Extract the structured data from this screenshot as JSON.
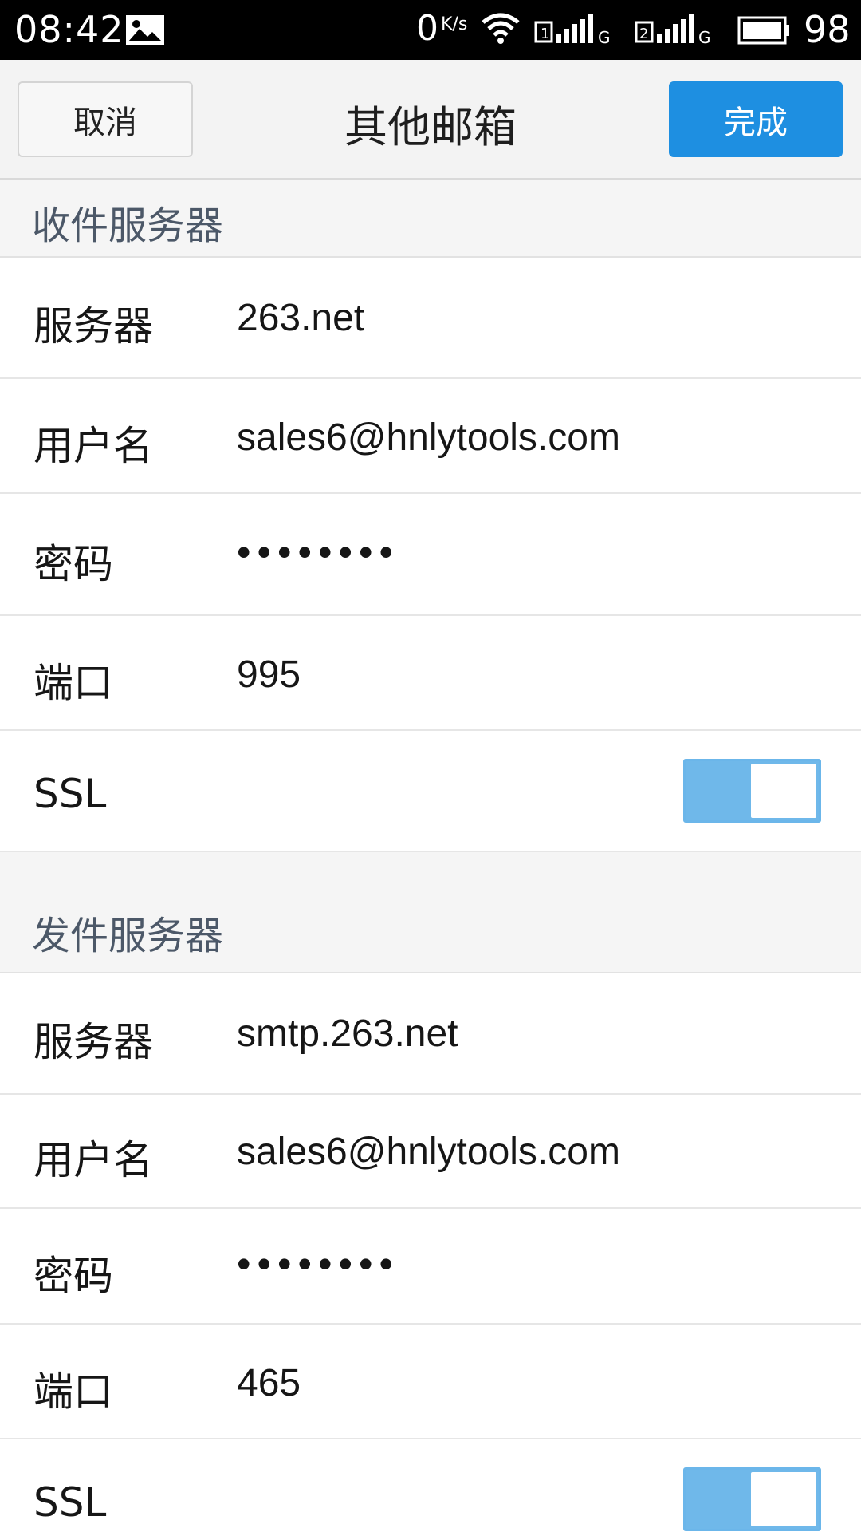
{
  "status_bar": {
    "time": "08:42",
    "net_speed": "0",
    "net_speed_unit": "K/s",
    "sim1": "1",
    "sim2": "2",
    "network_type": "G",
    "battery": "98",
    "icons": [
      "image-icon",
      "wifi-icon",
      "signal-icon",
      "battery-icon"
    ]
  },
  "title_bar": {
    "cancel_label": "取消",
    "title": "其他邮箱",
    "done_label": "完成",
    "done_color": "#1e8fe1"
  },
  "incoming": {
    "header": "收件服务器",
    "server_label": "服务器",
    "server_value": "263.net",
    "username_label": "用户名",
    "username_value": "sales6@hnlytools.com",
    "password_label": "密码",
    "password_value": "••••••••",
    "port_label": "端口",
    "port_value": "995",
    "ssl_label": "SSL",
    "ssl_on": true
  },
  "outgoing": {
    "header": "发件服务器",
    "server_label": "服务器",
    "server_value": "smtp.263.net",
    "username_label": "用户名",
    "username_value": "sales6@hnlytools.com",
    "password_label": "密码",
    "password_value": "••••••••",
    "port_label": "端口",
    "port_value": "465",
    "ssl_label": "SSL",
    "ssl_on": true
  },
  "colors": {
    "toggle_on": "#6fb8ea",
    "section_text": "#4c5868"
  }
}
